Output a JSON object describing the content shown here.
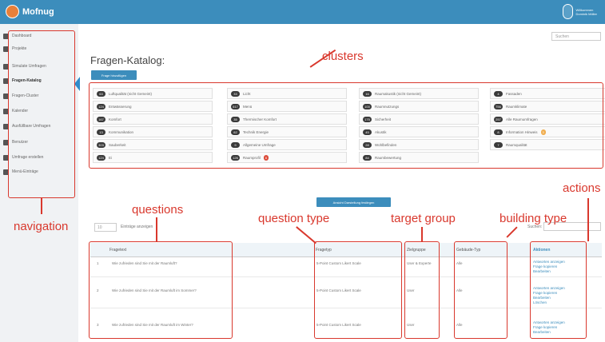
{
  "app": {
    "title": "Mofnug"
  },
  "user": {
    "line1": "Willkommen",
    "line2": "Dominik Möller"
  },
  "search": {
    "placeholder": "Suchen"
  },
  "sidebar": {
    "items": [
      {
        "label": "Dashboard",
        "icon": "dashboard-icon"
      },
      {
        "label": "Projekte",
        "icon": "folder-icon"
      },
      {
        "label": "Simulate Umfragen",
        "icon": "cogs-icon"
      },
      {
        "label": "Fragen-Katalog",
        "icon": "book-icon"
      },
      {
        "label": "Fragen-Cluster",
        "icon": "sitemap-icon"
      },
      {
        "label": "Kalender",
        "icon": "calendar-icon"
      },
      {
        "label": "Ausfüllbare Umfragen",
        "icon": "question-icon"
      },
      {
        "label": "Benutzer",
        "icon": "users-icon"
      },
      {
        "label": "Umfrage erstellen",
        "icon": "wrench-icon"
      },
      {
        "label": "Menü-Einträge",
        "icon": "envelope-icon"
      }
    ]
  },
  "main": {
    "title": "Fragen-Katalog:",
    "add_question_button": "Frage hinzufügen",
    "list_toggle_button": "Ansicht Darstellung festlegen",
    "entries_select": "10",
    "entries_label": "Einträge anzeigen",
    "table_search_label": "Suchen:",
    "clusters": [
      {
        "count": "63",
        "label": "Luftqualität (nicht Gemeint)"
      },
      {
        "count": "33",
        "label": "Licht"
      },
      {
        "count": "16",
        "label": "Raumakustik (nicht Gemeint)"
      },
      {
        "count": "4",
        "label": "Fassaden"
      },
      {
        "count": "124",
        "label": "Entwässerung"
      },
      {
        "count": "517",
        "label": "Menü"
      },
      {
        "count": "100",
        "label": "Raumnutzungs"
      },
      {
        "count": "756",
        "label": "Raumklimate"
      },
      {
        "count": "167",
        "label": "Komfort"
      },
      {
        "count": "35",
        "label": "Thermischer Komfort"
      },
      {
        "count": "175",
        "label": "Sicherheit"
      },
      {
        "count": "257",
        "label": "Alle Raumumfragen"
      },
      {
        "count": "13",
        "label": "Kommunikation"
      },
      {
        "count": "62",
        "label": "Technik Energie"
      },
      {
        "count": "45",
        "label": "Akustik"
      },
      {
        "count": "8",
        "label": "Information Hinweis",
        "badge": "3",
        "badge_color": "#f0ad4e"
      },
      {
        "count": "303",
        "label": "Sauberkeit"
      },
      {
        "count": "9",
        "label": "Allgemeine Umfrage"
      },
      {
        "count": "28",
        "label": "Wohlbefinden"
      },
      {
        "count": "7",
        "label": "Raumqualität"
      },
      {
        "count": "124",
        "label": "Ei"
      },
      {
        "count": "126",
        "label": "Raumprofil",
        "badge": "8",
        "badge_color": "#dd4b39"
      },
      {
        "count": "84",
        "label": "Raumbewertung"
      }
    ],
    "table": {
      "headers": [
        "Fragetext",
        "Fragetyp",
        "Zielgruppe",
        "Gebäude-Typ",
        "Aktionen"
      ],
      "rows": [
        {
          "num": "1",
          "question": "Wie zufrieden sind Sie mit der Raumluft?",
          "type": "5-Point Custom Likert Scale",
          "target": "User & Experte",
          "building": "Alle",
          "actions": [
            "Antworten anzeigen",
            "Frage kopieren",
            "Bearbeiten"
          ]
        },
        {
          "num": "2",
          "question": "Wie zufrieden sind Sie mit der Raumluft im Sommer?",
          "type": "5-Point Custom Likert Scale",
          "target": "User",
          "building": "Alle",
          "actions": [
            "Antworten anzeigen",
            "Frage kopieren",
            "Bearbeiten",
            "Löschen"
          ]
        },
        {
          "num": "3",
          "question": "Wie zufrieden sind Sie mit der Raumluft im Winter?",
          "type": "5-Point Custom Likert Scale",
          "target": "User",
          "building": "Alle",
          "actions": [
            "Antworten anzeigen",
            "Frage kopieren",
            "Bearbeiten"
          ]
        }
      ]
    }
  },
  "annotations": {
    "navigation": "navigation",
    "clusters": "clusters",
    "questions": "questions",
    "question_type": "question type",
    "target_group": "target group",
    "building_type": "building type",
    "actions": "actions"
  },
  "colors": {
    "header": "#3c8dbc",
    "annotation": "#d9382d",
    "sidebar_bg": "#f0f2f4"
  }
}
